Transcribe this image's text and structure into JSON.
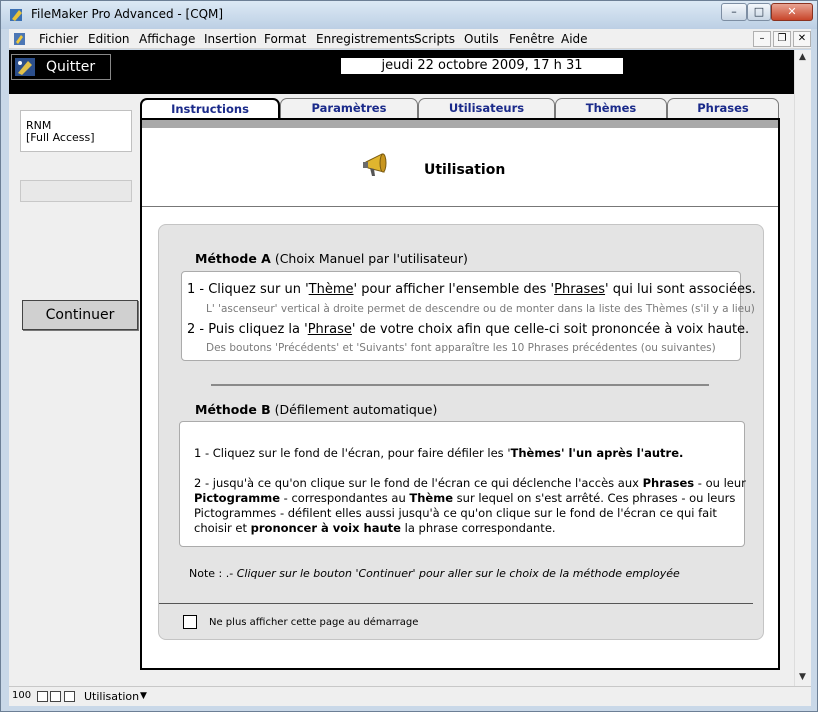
{
  "window": {
    "title": "FileMaker Pro Advanced - [CQM]",
    "min": "–",
    "max": "□",
    "close": "✕"
  },
  "menu": [
    "Fichier",
    "Edition",
    "Affichage",
    "Insertion",
    "Format",
    "Enregistrements",
    "Scripts",
    "Outils",
    "Fenêtre",
    "Aide"
  ],
  "mdi": {
    "min": "–",
    "restore": "❐",
    "close": "✕"
  },
  "header": {
    "quit_label": "Quitter",
    "datetime": "jeudi 22 octobre 2009, 17 h 31"
  },
  "user": {
    "line1": "RNM",
    "line2": "[Full Access]"
  },
  "continue_label": "Continuer",
  "tabs": [
    "Instructions",
    "Paramètres",
    "Utilisateurs",
    "Thèmes",
    "Phrases"
  ],
  "section_title": "Utilisation",
  "methodA": {
    "title": "Méthode A",
    "subtitle": "(Choix Manuel par l'utilisateur)",
    "l1a": "1 - Cliquez sur un '",
    "l1b": "Thème",
    "l1c": "' pour afficher l'ensemble des '",
    "l1d": "Phrases",
    "l1e": "' qui lui sont associées.",
    "sub1": "L' 'ascenseur' vertical à droite  permet de descendre ou de monter dans la liste des Thèmes (s'il y a lieu)",
    "l2a": "2 - Puis cliquez la '",
    "l2b": "Phrase",
    "l2c": "' de votre choix afin que celle-ci soit prononcée à voix haute.",
    "sub2": "Des boutons 'Précédents' et 'Suivants'  font apparaître les 10 Phrases précédentes (ou suivantes)"
  },
  "methodB": {
    "title": "Méthode B",
    "subtitle": "(Défilement automatique)",
    "p1a": "1 - Cliquez sur le fond de l'écran, pour faire défiler les '",
    "p1b": "Thèmes' l'un après l'autre.",
    "p2_l1a": "2 - jusqu'à ce qu'on clique sur le fond de l'écran ce qui déclenche l'accès aux ",
    "p2_l1b": "Phrases",
    "p2_l1c": " - ou leur",
    "p2_l2a": "Pictogramme",
    "p2_l2b": " -  correspondantes au ",
    "p2_l2c": "Thème",
    "p2_l2d": " sur lequel on s'est arrêté. Ces phrases - ou leurs",
    "p2_l3": "Pictogrammes -   défilent elles aussi jusqu'à ce qu'on clique sur le fond de l'écran ce qui fait",
    "p2_l4a": "choisir et ",
    "p2_l4b": "prononcer à voix haute",
    "p2_l4c": " la phrase correspondante."
  },
  "note": {
    "label": "Note : .- ",
    "text": "Cliquer sur le bouton 'Continuer' pour aller sur le choix de la méthode employée"
  },
  "checkbox_label": "Ne plus afficher cette page au démarrage",
  "status": {
    "zoom": "100",
    "mode": "Utilisation"
  }
}
